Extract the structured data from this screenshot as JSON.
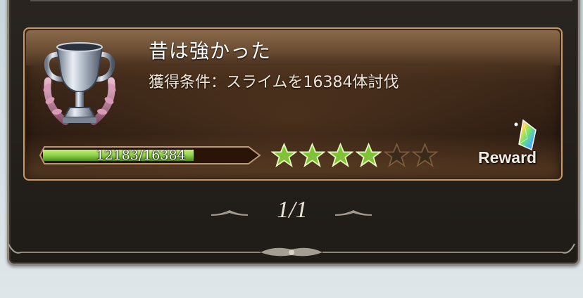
{
  "achievement": {
    "title": "昔は強かった",
    "condition": "獲得条件：スライムを16384体討伐",
    "progress_text": "12183/16384",
    "progress_current": 12183,
    "progress_total": 16384,
    "stars_total": 6,
    "stars_filled": 4,
    "reward_label": "Reward"
  },
  "pager": {
    "page_text": "1/1"
  },
  "colors": {
    "star_filled": "#7fc23a",
    "star_empty": "#3a2a1a",
    "progress_fill": "#8fd14a",
    "card_border": "#c49a6a"
  },
  "icons": [
    "trophy-icon",
    "star-icon",
    "rainbow-crystal-icon",
    "prev-arrow-icon",
    "next-arrow-icon"
  ]
}
